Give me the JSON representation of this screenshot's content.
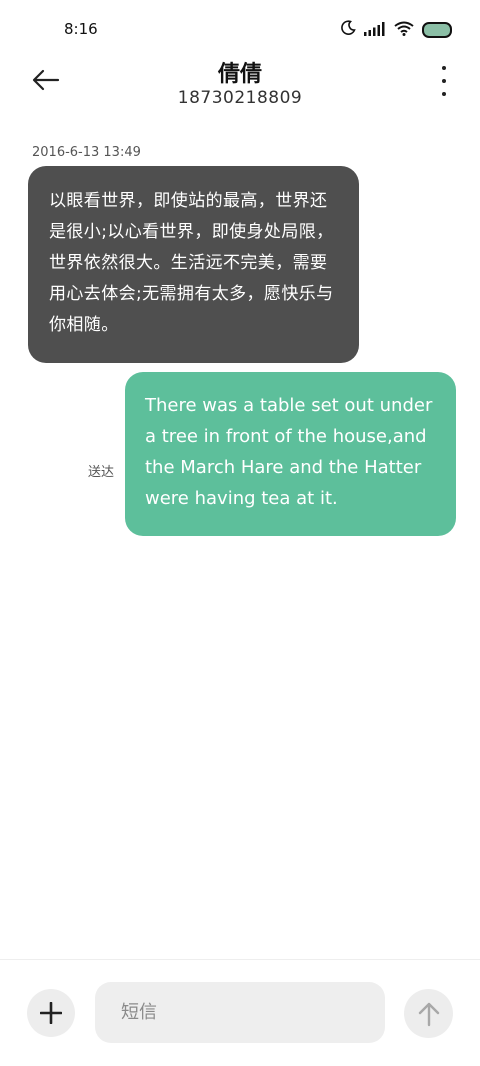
{
  "status_bar": {
    "time": "8:16",
    "icons": [
      "moon-icon",
      "signal-icon",
      "wifi-icon",
      "battery-icon"
    ],
    "battery_color": "#8bbfa6"
  },
  "header": {
    "back_icon": "back-arrow-icon",
    "contact_name": "倩倩",
    "phone_number": "18730218809",
    "more_icon": "more-vertical-icon"
  },
  "conversation": {
    "timestamp": "2016-6-13 13:49",
    "messages": [
      {
        "direction": "incoming",
        "text": "以眼看世界，即使站的最高，世界还是很小;以心看世界，即使身处局限，世界依然很大。生活远不完美，需要用心去体会;无需拥有太多，愿快乐与你相随。",
        "bubble_color": "#4f4f4f"
      },
      {
        "direction": "outgoing",
        "text": "There was a table set out under a tree in front of the house,and the March Hare and the Hatter were having tea at it.",
        "status": "送达",
        "bubble_color": "#5dbf9b"
      }
    ]
  },
  "composer": {
    "add_icon": "plus-icon",
    "placeholder": "短信",
    "value": "",
    "send_icon": "send-arrow-up-icon"
  }
}
